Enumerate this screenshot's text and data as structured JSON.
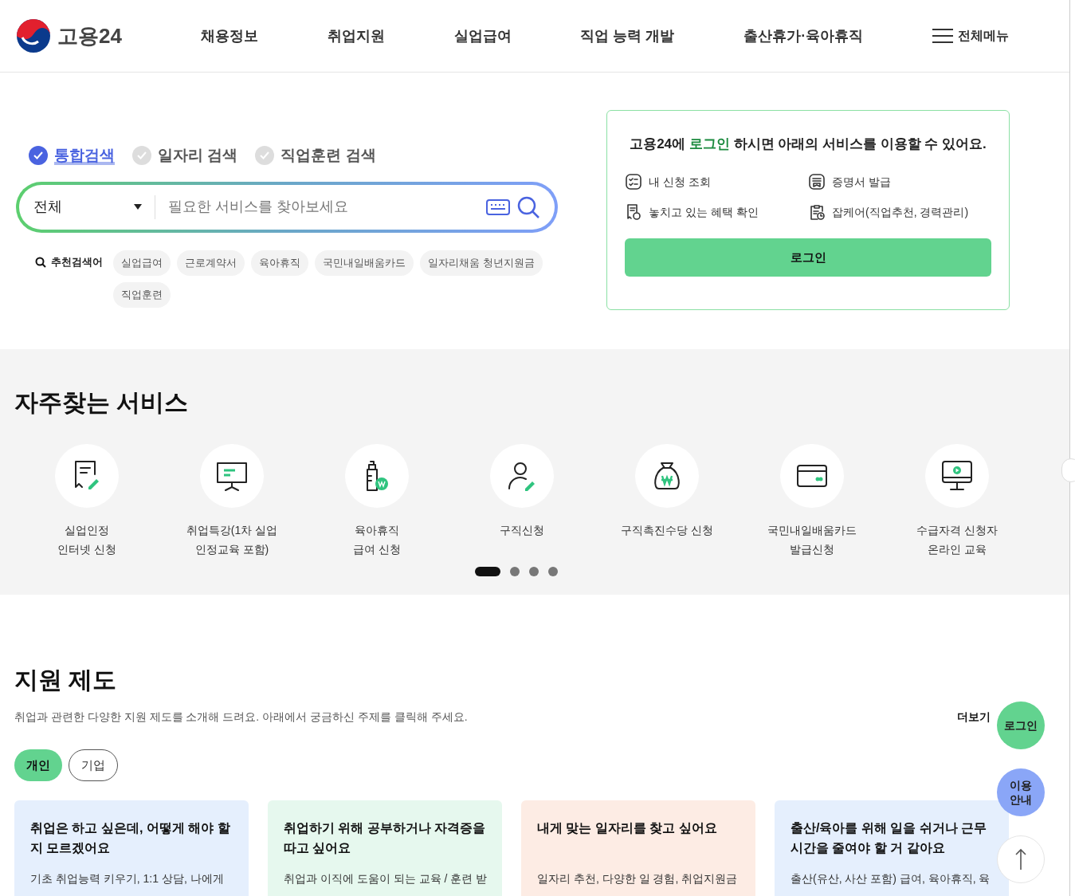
{
  "header": {
    "logo_text": "고용24",
    "nav": [
      "채용정보",
      "취업지원",
      "실업급여",
      "직업 능력 개발",
      "출산휴가·육아휴직"
    ],
    "all_menu": "전체메뉴"
  },
  "search": {
    "types": [
      {
        "label": "통합검색",
        "selected": true
      },
      {
        "label": "일자리 검색",
        "selected": false
      },
      {
        "label": "직업훈련 검색",
        "selected": false
      }
    ],
    "category": "전체",
    "placeholder": "필요한 서비스를 찾아보세요",
    "recommended_label": "추천검색어",
    "keywords": [
      "실업급여",
      "근로계약서",
      "육아휴직",
      "국민내일배움카드",
      "일자리채움 청년지원금",
      "직업훈련"
    ]
  },
  "login_box": {
    "message": "고용24에 **로그인** 하시면 아래의 서비스를 이용할 수 있어요.",
    "services": [
      {
        "kind": "list",
        "label": "내 신청 조회"
      },
      {
        "kind": "certificate",
        "label": "증명서 발급"
      },
      {
        "kind": "receipt",
        "label": "놓치고 있는 혜택 확인"
      },
      {
        "kind": "clipboard",
        "label": "잡케어(직업추천, 경력관리)"
      }
    ],
    "button": "로그인"
  },
  "frequent": {
    "title": "자주찾는 서비스",
    "items": [
      {
        "kind": "doc",
        "label": "실업인정\n인터넷 신청"
      },
      {
        "kind": "board",
        "label": "취업특강(1차 실업\n인정교육 포함)"
      },
      {
        "kind": "bottle",
        "label": "육아휴직\n급여 신청"
      },
      {
        "kind": "person",
        "label": "구직신청"
      },
      {
        "kind": "bag",
        "label": "구직촉진수당 신청"
      },
      {
        "kind": "card",
        "label": "국민내일배움카드\n발급신청"
      },
      {
        "kind": "monitor",
        "label": "수급자격 신청자\n온라인 교육"
      }
    ],
    "pages": [
      {
        "selected": true
      },
      {
        "selected": false
      },
      {
        "selected": false
      },
      {
        "selected": false
      }
    ]
  },
  "support": {
    "title": "지원 제도",
    "description": "취업과 관련한 다양한 지원 제도를 소개해 드려요. 아래에서 궁금하신 주제를 클릭해 주세요.",
    "more": "더보기",
    "tabs": [
      {
        "label": "개인",
        "selected": true
      },
      {
        "label": "기업",
        "selected": false
      }
    ],
    "cards": [
      {
        "title": "취업은 하고 싶은데, 어떻게 해야 할 지 모르겠어요",
        "text": "기초 취업능력 키우기, 1:1 상담, 나에게",
        "color": "#e5effd"
      },
      {
        "title": "취업하기 위해 공부하거나 자격증을 따고 싶어요",
        "text": "취업과 이직에 도움이 되는 교육 / 훈련 받",
        "color": "#e6f8ee"
      },
      {
        "title": "내게 맞는 일자리를 찾고 싶어요",
        "text": "일자리 추천, 다양한 일 경험, 취업지원금",
        "color": "#fdece4"
      },
      {
        "title": "출산/육아를 위해 일을 쉬거나 근무 시간을 줄여야 할 거 같아요",
        "text": "출산(유산, 사산 포함) 급여, 육아휴직, 육",
        "color": "#e5effd"
      }
    ]
  },
  "floating": {
    "login": "로그인",
    "guide": "이용\n안내"
  }
}
